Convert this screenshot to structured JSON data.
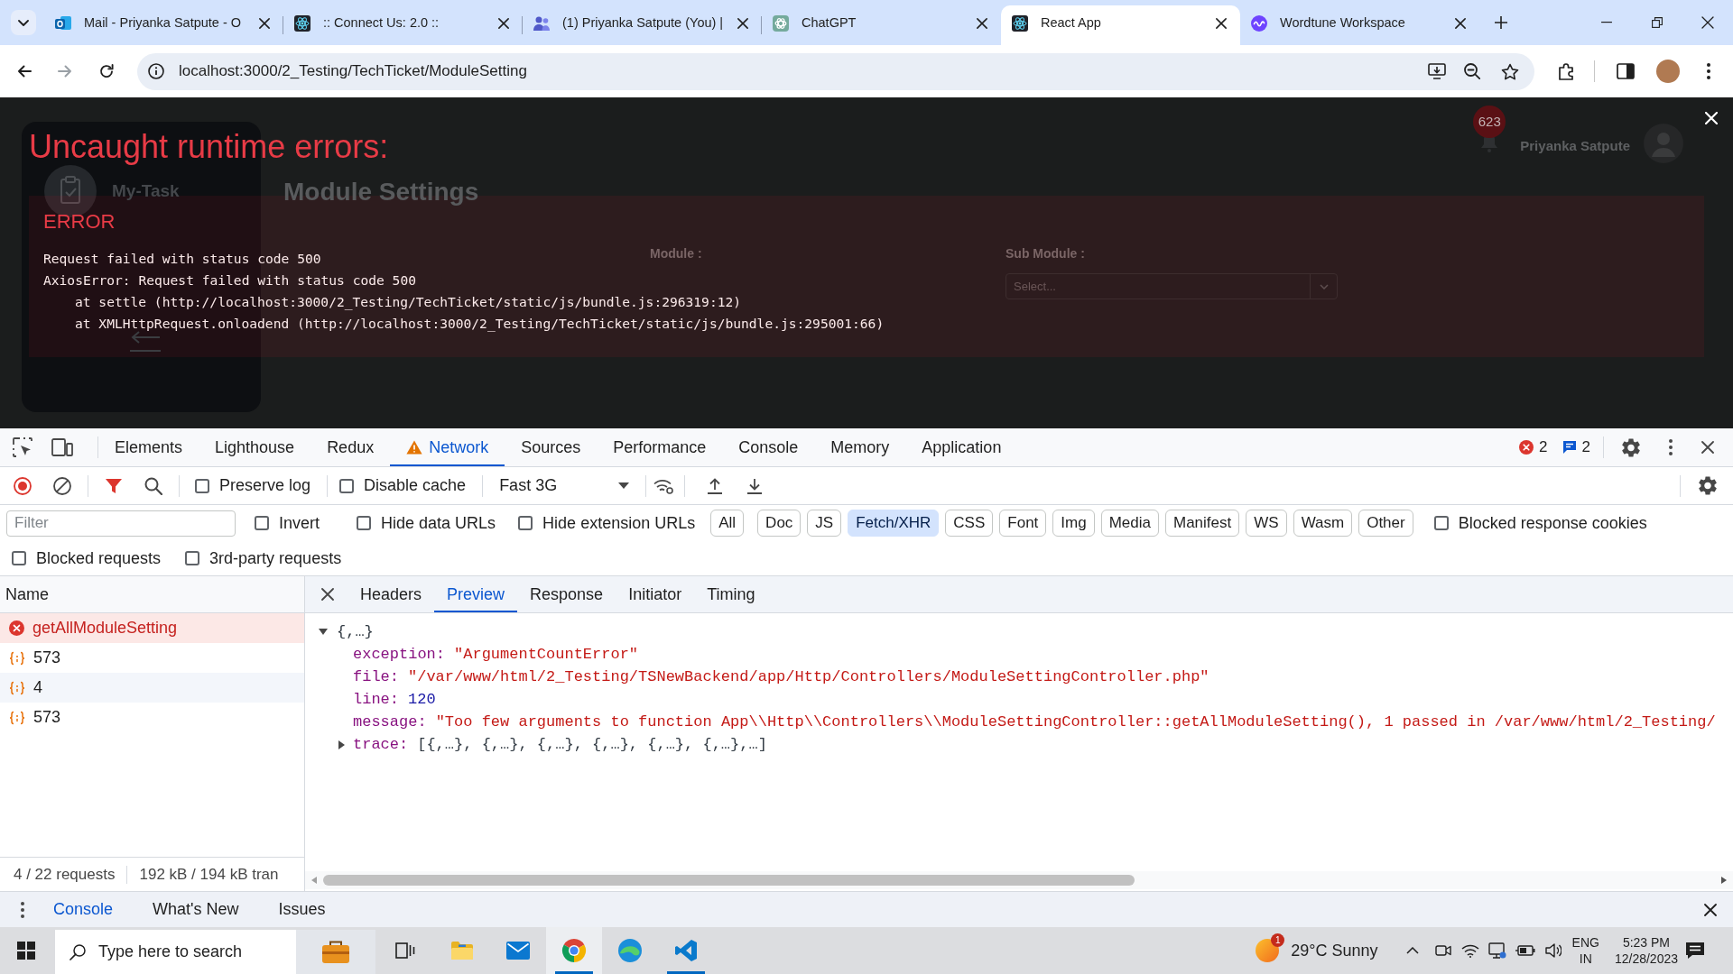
{
  "browser": {
    "tabs": [
      {
        "title": "Mail - Priyanka Satpute - O",
        "kind": "mail",
        "selected": false
      },
      {
        "title": ":: Connect Us: 2.0 ::",
        "kind": "atom",
        "selected": false
      },
      {
        "title": "(1) Priyanka Satpute (You) |",
        "kind": "people",
        "selected": false
      },
      {
        "title": "ChatGPT",
        "kind": "knot",
        "selected": false
      },
      {
        "title": "React App",
        "kind": "atom",
        "selected": true
      },
      {
        "title": "Wordtune Workspace",
        "kind": "wave",
        "selected": false
      }
    ],
    "url": "localhost:3000/2_Testing/TechTicket/ModuleSetting"
  },
  "app": {
    "notification_count": "623",
    "user_name": "Priyanka Satpute",
    "sidebar_title": "My-Task",
    "page_title": "Module Settings",
    "fields": [
      {
        "label": "Module :"
      },
      {
        "label": "Sub Module :",
        "placeholder": "Select..."
      }
    ]
  },
  "error_overlay": {
    "title": "Uncaught runtime errors:",
    "errors": [
      {
        "label": "ERROR",
        "messages": [
          "Request failed with status code 500",
          "AxiosError: Request failed with status code 500"
        ],
        "frames": [
          "at settle (http://localhost:3000/2_Testing/TechTicket/static/js/bundle.js:296319:12)",
          "at XMLHttpRequest.onloadend (http://localhost:3000/2_Testing/TechTicket/static/js/bundle.js:295001:66)"
        ]
      }
    ]
  },
  "devtools": {
    "panel_tabs": [
      {
        "label": "Elements",
        "selected": false,
        "warning": false
      },
      {
        "label": "Lighthouse",
        "selected": false,
        "warning": false
      },
      {
        "label": "Redux",
        "selected": false,
        "warning": false
      },
      {
        "label": "Network",
        "selected": true,
        "warning": true
      },
      {
        "label": "Sources",
        "selected": false,
        "warning": false
      },
      {
        "label": "Performance",
        "selected": false,
        "warning": false
      },
      {
        "label": "Console",
        "selected": false,
        "warning": false
      },
      {
        "label": "Memory",
        "selected": false,
        "warning": false
      },
      {
        "label": "Application",
        "selected": false,
        "warning": false
      }
    ],
    "issues": {
      "errors": "2",
      "messages": "2"
    },
    "toolbar": {
      "recording": true,
      "filter_active": true,
      "options": [
        {
          "label": "Preserve log",
          "checked": false
        },
        {
          "label": "Disable cache",
          "checked": false
        }
      ],
      "throttling": "Fast 3G"
    },
    "filter": {
      "placeholder": "Filter",
      "options": [
        {
          "label": "Invert",
          "checked": false
        },
        {
          "label": "Hide data URLs",
          "checked": false
        },
        {
          "label": "Hide extension URLs",
          "checked": false
        }
      ],
      "types": [
        {
          "label": "All",
          "selected": false
        },
        {
          "label": "Doc",
          "selected": false
        },
        {
          "label": "JS",
          "selected": false
        },
        {
          "label": "Fetch/XHR",
          "selected": true
        },
        {
          "label": "CSS",
          "selected": false
        },
        {
          "label": "Font",
          "selected": false
        },
        {
          "label": "Img",
          "selected": false
        },
        {
          "label": "Media",
          "selected": false
        },
        {
          "label": "Manifest",
          "selected": false
        },
        {
          "label": "WS",
          "selected": false
        },
        {
          "label": "Wasm",
          "selected": false
        },
        {
          "label": "Other",
          "selected": false
        }
      ],
      "more_options": [
        {
          "label": "Blocked response cookies",
          "checked": false
        }
      ],
      "second_row": [
        {
          "label": "Blocked requests",
          "checked": false
        },
        {
          "label": "3rd-party requests",
          "checked": false
        }
      ]
    },
    "requests": {
      "column": "Name",
      "rows": [
        {
          "name": "getAllModuleSetting",
          "kind": "error",
          "selected": true
        },
        {
          "name": "573",
          "kind": "fetch",
          "selected": false
        },
        {
          "name": "4",
          "kind": "fetch",
          "selected": false
        },
        {
          "name": "573",
          "kind": "fetch",
          "selected": false
        }
      ],
      "summary": [
        "4 / 22 requests",
        "192 kB / 194 kB tran"
      ]
    },
    "detail": {
      "tabs": [
        {
          "label": "Headers",
          "selected": false
        },
        {
          "label": "Preview",
          "selected": true
        },
        {
          "label": "Response",
          "selected": false
        },
        {
          "label": "Initiator",
          "selected": false
        },
        {
          "label": "Timing",
          "selected": false
        }
      ],
      "preview": {
        "root": {
          "summary": "{,…}",
          "expanded": true
        },
        "properties": [
          {
            "key": "exception:",
            "value": "\"ArgumentCountError\"",
            "kind": "string"
          },
          {
            "key": "file:",
            "value": "\"/var/www/html/2_Testing/TSNewBackend/app/Http/Controllers/ModuleSettingController.php\"",
            "kind": "string"
          },
          {
            "key": "line:",
            "value": "120",
            "kind": "number"
          },
          {
            "key": "message:",
            "value": "\"Too few arguments to function App\\\\Http\\\\Controllers\\\\ModuleSettingController::getAllModuleSetting(), 1 passed in /var/www/html/2_Testing/",
            "kind": "string"
          },
          {
            "key": "trace:",
            "value": "[{,…}, {,…}, {,…}, {,…}, {,…}, {,…},…]",
            "kind": "array",
            "expanded": false
          }
        ]
      }
    },
    "drawer": {
      "tabs": [
        {
          "label": "Console",
          "selected": true
        },
        {
          "label": "What's New",
          "selected": false
        },
        {
          "label": "Issues",
          "selected": false
        }
      ]
    }
  },
  "taskbar": {
    "search": {
      "placeholder": "Type here to search"
    },
    "apps": [
      {
        "kind": "folder",
        "running": false,
        "selected": false
      },
      {
        "kind": "envelope",
        "running": false,
        "selected": false
      },
      {
        "kind": "ring",
        "running": true,
        "selected": true
      },
      {
        "kind": "swirl",
        "running": false,
        "selected": false
      },
      {
        "kind": "ribbon",
        "running": true,
        "selected": false
      }
    ],
    "weather": {
      "badge": "1",
      "text": "29°C Sunny"
    },
    "language": {
      "input": "ENG",
      "region": "IN"
    },
    "clock": {
      "time": "5:23 PM",
      "date": "12/28/2023"
    }
  }
}
